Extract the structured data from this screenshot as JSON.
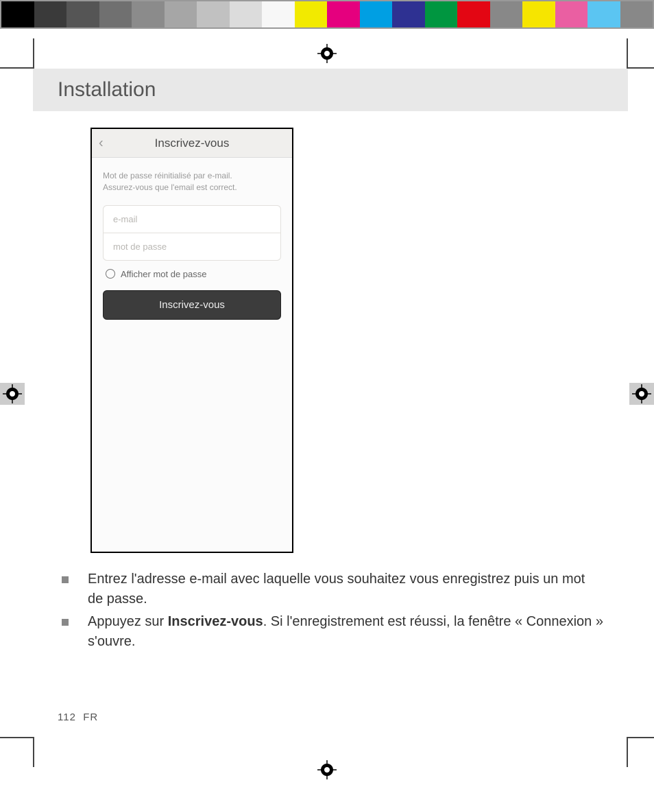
{
  "colorbar": [
    "#000000",
    "#3a3a3a",
    "#555555",
    "#707070",
    "#8b8b8b",
    "#a6a6a6",
    "#c1c1c1",
    "#dcdcdc",
    "#f7f7f7",
    "#f2ea00",
    "#e5007e",
    "#009fe3",
    "#2e3192",
    "#009640",
    "#e30613",
    "#888888",
    "#f6e500",
    "#ea5fa2",
    "#5bc5f2",
    "#888888"
  ],
  "header": {
    "title": "Installation"
  },
  "phone": {
    "title": "Inscrivez-vous",
    "hint_line1": "Mot de passe réinitialisé par e-mail.",
    "hint_line2": "Assurez-vous que l'email est correct.",
    "email_placeholder": "e-mail",
    "password_placeholder": "mot de passe",
    "show_password_label": "Afficher mot de passe",
    "submit_label": "Inscrivez-vous"
  },
  "instructions": {
    "item1": "Entrez l'adresse e-mail avec laquelle vous souhaitez vous enregistrez puis un mot de passe.",
    "item2_pre": "Appuyez sur ",
    "item2_bold": "Inscrivez-vous",
    "item2_post": ". Si l'enregistrement est réussi, la fenêtre « Connexion » s'ouvre."
  },
  "footer": {
    "page": "112",
    "lang": "FR"
  }
}
